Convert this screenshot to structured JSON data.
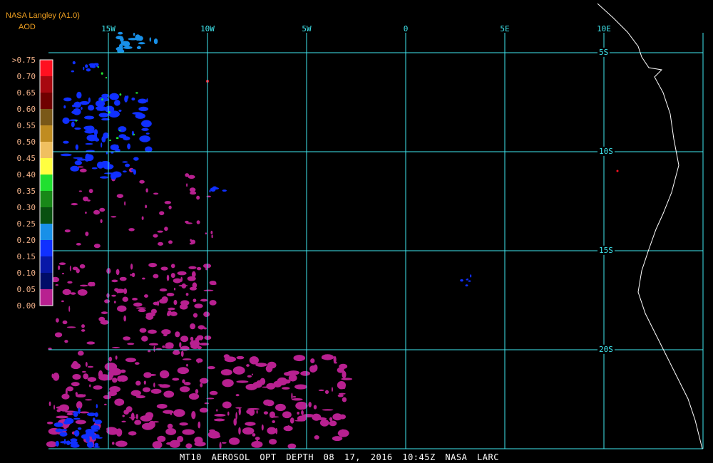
{
  "header": {
    "title": "NASA Langley (A1.0)",
    "unit": "AOD"
  },
  "legend": {
    "labels": [
      ">0.75",
      "0.70",
      "0.65",
      "0.60",
      "0.55",
      "0.50",
      "0.45",
      "0.40",
      "0.35",
      "0.30",
      "0.25",
      "0.20",
      "0.15",
      "0.10",
      "0.05",
      "0.00"
    ],
    "colors": [
      "#ff1020",
      "#a80810",
      "#700000",
      "#7a5818",
      "#c08c20",
      "#f0c060",
      "#ffff40",
      "#20e030",
      "#188818",
      "#085010",
      "#1890e8",
      "#1030ff",
      "#0818a8",
      "#000c68",
      "#b82090"
    ]
  },
  "grid": {
    "longitudes": [
      "15W",
      "10W",
      "5W",
      "0",
      "5E",
      "10E"
    ],
    "latitudes": [
      "5S",
      "10S",
      "15S",
      "20S"
    ],
    "line_color": "#40e8f0"
  },
  "caption": "MT10  AEROSOL OPT DEPTH  08 17, 2016 10:45Z  NASA LARC"
}
